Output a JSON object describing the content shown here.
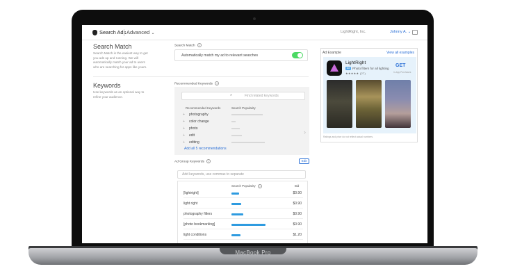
{
  "device": {
    "brand": "MacBook Pro"
  },
  "header": {
    "app_title": "Search Ads",
    "mode": "Advanced",
    "org": "LightRight, Inc.",
    "user": "Johnny A."
  },
  "search_match": {
    "title": "Search Match",
    "description": "Search Match is the easiest way to get you ads up and running. We will automatically match your ad to users who are searching for apps like yours.",
    "label": "Search Match",
    "toggle_text": "Automatically match my ad to relevant searches",
    "enabled": true
  },
  "keywords": {
    "title": "Keywords",
    "description": "Use keywords as an optional way to refine your audience.",
    "recommended_label": "Recommended Keywords",
    "search_placeholder": "Find related keywords",
    "columns": [
      "Recommended Keywords",
      "Search Popularity"
    ],
    "recommended": [
      {
        "keyword": "photography",
        "popularity": 0.75
      },
      {
        "keyword": "color change",
        "popularity": 0.1
      },
      {
        "keyword": "photo",
        "popularity": 0.2
      },
      {
        "keyword": "edit",
        "popularity": 0.25
      },
      {
        "keyword": "editing",
        "popularity": 0.8
      }
    ],
    "add_all_link": "Add all 5 recommendations",
    "ad_group_label": "Ad Group Keywords",
    "edit_label": "Edit",
    "ad_group_placeholder": "Add keywords, use commas to separate",
    "table_columns": [
      "Search Popularity",
      "Bid"
    ],
    "ad_group": [
      {
        "keyword": "[lightright]",
        "popularity": 0.12,
        "bid": "$0.90"
      },
      {
        "keyword": "light right",
        "popularity": 0.15,
        "bid": "$0.90"
      },
      {
        "keyword": "photography filters",
        "popularity": 0.18,
        "bid": "$0.90"
      },
      {
        "keyword": "[photo bookmarking]",
        "popularity": 0.52,
        "bid": "$0.90"
      },
      {
        "keyword": "light conditions",
        "popularity": 0.14,
        "bid": "$1.20"
      }
    ]
  },
  "ad_example": {
    "title": "Ad Example",
    "link": "View all examples",
    "app_name": "LightRight",
    "badge": "Ad",
    "subtitle": "Photo filters for all lighting",
    "rating_text": "★★★★★ (27)",
    "get_label": "GET",
    "iap_text": "In-App Purchases",
    "footnote": "Ratings and price do not reflect actual numbers."
  },
  "colors": {
    "accent": "#2a6fd6",
    "toggle_on": "#4cd964",
    "bar": "#2e9be0",
    "ad_card_bg": "#e6f2fb"
  }
}
